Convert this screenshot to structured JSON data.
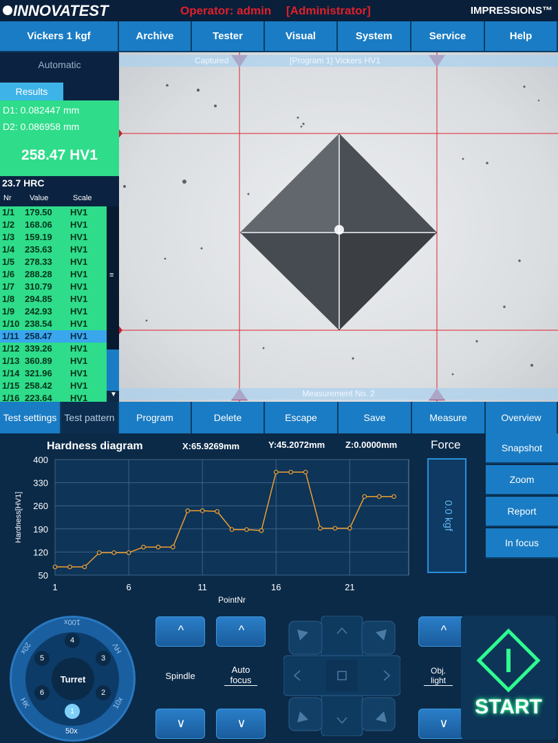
{
  "header": {
    "logo": "INNOVATEST",
    "operator": "Operator: admin",
    "role": "[Administrator]",
    "brand": "IMPRESSIONS™"
  },
  "menu": [
    "Vickers 1 kgf",
    "Archive",
    "Tester",
    "Visual",
    "System",
    "Service",
    "Help"
  ],
  "left": {
    "mode": "Automatic",
    "results_tab": "Results",
    "d1": "D1: 0.082447 mm",
    "d2": "D2: 0.086958 mm",
    "hardness": "258.47 HV1",
    "hrc": "23.7 HRC",
    "cols": [
      "Nr",
      "Value",
      "Scale"
    ],
    "rows": [
      [
        "1/1",
        "179.50",
        "HV1"
      ],
      [
        "1/2",
        "168.06",
        "HV1"
      ],
      [
        "1/3",
        "159.19",
        "HV1"
      ],
      [
        "1/4",
        "235.63",
        "HV1"
      ],
      [
        "1/5",
        "278.33",
        "HV1"
      ],
      [
        "1/6",
        "288.28",
        "HV1"
      ],
      [
        "1/7",
        "310.79",
        "HV1"
      ],
      [
        "1/8",
        "294.85",
        "HV1"
      ],
      [
        "1/9",
        "242.93",
        "HV1"
      ],
      [
        "1/10",
        "238.54",
        "HV1"
      ],
      [
        "1/11",
        "258.47",
        "HV1"
      ],
      [
        "1/12",
        "339.26",
        "HV1"
      ],
      [
        "1/13",
        "360.89",
        "HV1"
      ],
      [
        "1/14",
        "321.96",
        "HV1"
      ],
      [
        "1/15",
        "258.42",
        "HV1"
      ],
      [
        "1/16",
        "223.64",
        "HV1"
      ]
    ],
    "selected_row": 10
  },
  "view": {
    "captured": "Captured",
    "program": "[Program 1] Vickers HV1",
    "measurement": "Measurement No. 2"
  },
  "buttons": [
    "Test settings",
    "Test pattern",
    "Program",
    "Delete",
    "Escape",
    "Save",
    "Measure",
    "Overview"
  ],
  "side_buttons": [
    "Snapshot",
    "Zoom",
    "Report",
    "In focus"
  ],
  "diagram": {
    "title": "Hardness diagram",
    "x": "X:65.9269mm",
    "y": "Y:45.2072mm",
    "z": "Z:0.0000mm",
    "force_label": "Force",
    "force_value": "0.0 kgf"
  },
  "chart_data": {
    "type": "line",
    "title": "Hardness diagram",
    "xlabel": "PointNr",
    "ylabel": "Hardness[HV1]",
    "xlim": [
      1,
      25
    ],
    "ylim": [
      50,
      400
    ],
    "xticks": [
      1,
      6,
      11,
      16,
      21
    ],
    "yticks": [
      50,
      120,
      190,
      260,
      330,
      400
    ],
    "x": [
      1,
      2,
      3,
      4,
      5,
      6,
      7,
      8,
      9,
      10,
      11,
      12,
      13,
      14,
      15,
      16,
      17,
      18,
      19,
      20,
      21,
      22,
      23,
      24
    ],
    "values": [
      75,
      75,
      75,
      118,
      118,
      118,
      135,
      135,
      135,
      245,
      245,
      243,
      188,
      188,
      185,
      362,
      362,
      362,
      192,
      192,
      192,
      288,
      288,
      288
    ],
    "color": "#f0a030",
    "grid": true
  },
  "controls": {
    "turret": "Turret",
    "positions": [
      "1",
      "2",
      "3",
      "4",
      "5",
      "6"
    ],
    "active_position": "1",
    "ring_labels": [
      "100x",
      "HV",
      "10x",
      "50x",
      "HK",
      "20x"
    ],
    "spindle": "Spindle",
    "autofocus": "Auto focus",
    "objlight": "Obj. light",
    "start": "START"
  },
  "colors": {
    "accent": "#1a7cc4",
    "result": "#2edc8a",
    "selected": "#3aa6ee",
    "line": "#f0a030",
    "alert": "#e0202a"
  }
}
